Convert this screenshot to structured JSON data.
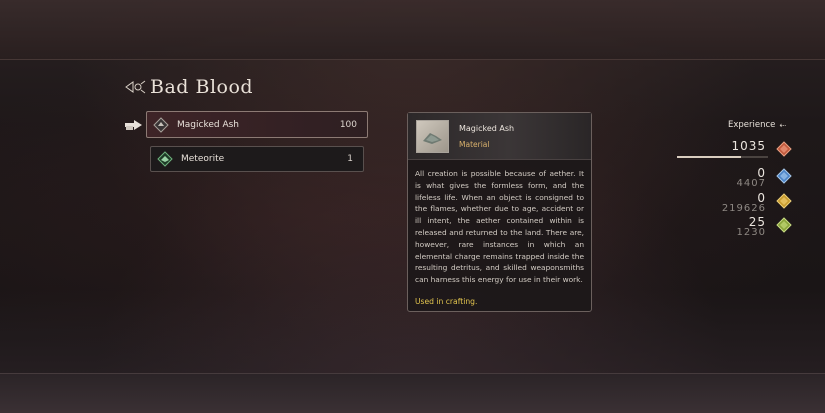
{
  "title": "Bad Blood",
  "items": [
    {
      "label": "Magicked Ash",
      "count": "100",
      "icon": "magicked-ash-icon",
      "selected": true
    },
    {
      "label": "Meteorite",
      "count": "1",
      "icon": "meteorite-icon",
      "selected": false
    }
  ],
  "detail": {
    "name": "Magicked Ash",
    "type": "Material",
    "description": "All creation is possible because of aether. It is what gives the formless form, and the lifeless life. When an object is consigned to the flames, whether due to age, accident or ill intent, the aether contained within is released and returned to the land. There are, however, rare instances in which an elemental charge remains trapped inside the resulting detritus, and skilled weaponsmiths can harness this energy for use in their work.",
    "footer": "Used in crafting."
  },
  "experience": {
    "label": "Experience",
    "rows": [
      {
        "value": "1035",
        "sub": "",
        "gem_color": "#c0583c",
        "bar_fraction": 0.7
      },
      {
        "value": "0",
        "sub": "4407",
        "gem_color": "#4b83c6"
      },
      {
        "value": "0",
        "sub": "219626",
        "gem_color": "#c79a2e"
      },
      {
        "value": "25",
        "sub": "1230",
        "gem_color": "#8aa33a"
      }
    ]
  },
  "colors": {
    "accent_yellow": "#e3c54f",
    "type_gold": "#d9b16c",
    "selected_bg": "#3e2427"
  }
}
